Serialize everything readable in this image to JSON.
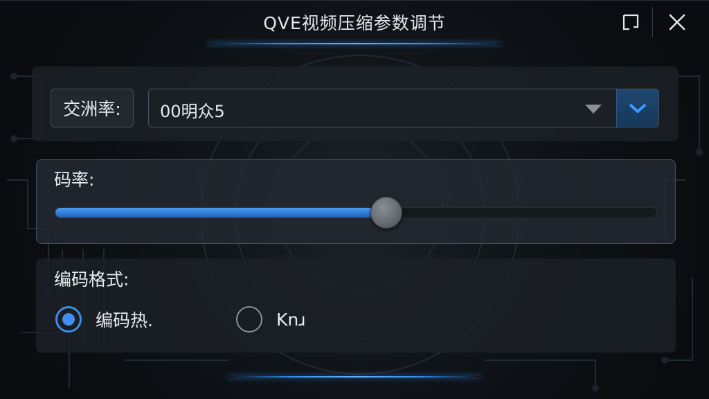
{
  "window": {
    "title": "QVE视频压缩参数调节",
    "maximize_icon": "maximize-icon",
    "close_icon": "close-icon",
    "accent_color": "#2f8ef0"
  },
  "frame_rate": {
    "label": "交洲率:",
    "selected_value": "00明众5",
    "dropdown_icon": "chevron-down-icon"
  },
  "bitrate": {
    "label": "码率:",
    "value_fraction": 0.55
  },
  "format": {
    "label": "编码格式:",
    "options": [
      {
        "label": "编码热.",
        "selected": true
      },
      {
        "label": "Knɹ",
        "selected": false
      }
    ]
  }
}
